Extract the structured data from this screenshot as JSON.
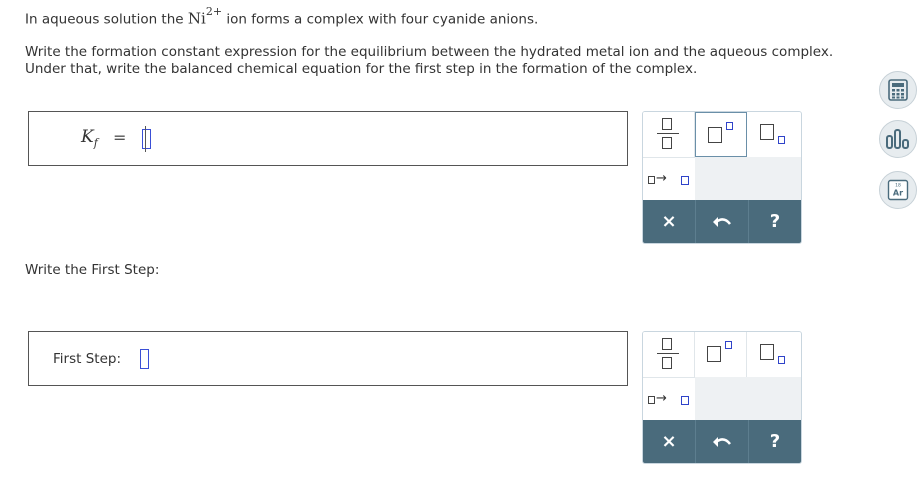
{
  "question": {
    "intro_before": "In aqueous solution the",
    "ion_symbol": "Ni",
    "ion_charge": "2+",
    "intro_after": "ion forms a complex with four cyanide anions.",
    "instruction_line1": "Write the formation constant expression for the equilibrium between the hydrated metal ion and the aqueous complex.",
    "instruction_line2": "Under that, write the balanced chemical equation for the first step in the formation of the complex."
  },
  "answer1": {
    "symbol": "K",
    "subscript": "f",
    "equals": "="
  },
  "write_first_step_label": "Write the First Step:",
  "answer2": {
    "label": "First Step:"
  },
  "palette": {
    "clear_label": "×",
    "help_label": "?",
    "arrow_label": "→"
  },
  "side_tools": {
    "periodic_number": "18",
    "periodic_symbol": "Ar"
  },
  "colors": {
    "toolbar_bg": "#4a6b7c",
    "cursor_blue": "#3a4fd6"
  }
}
